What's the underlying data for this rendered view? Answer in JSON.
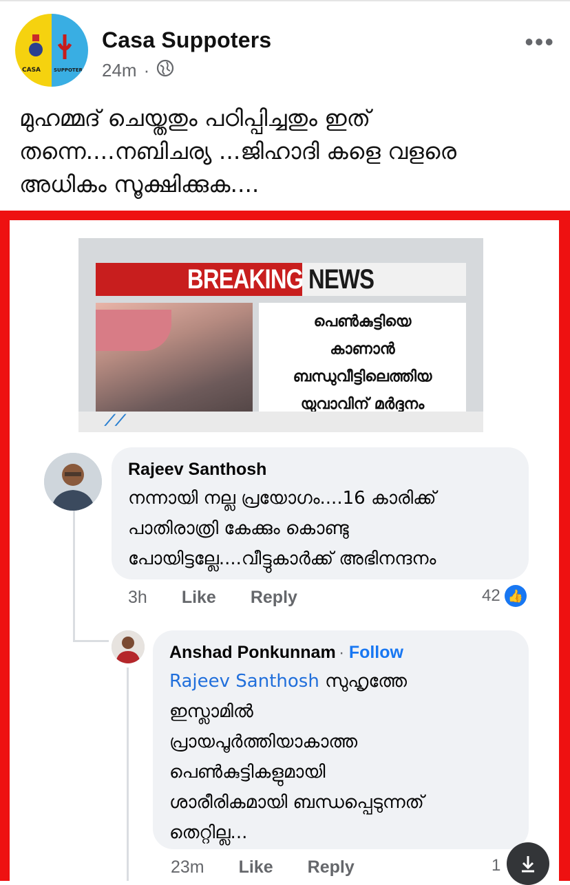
{
  "post": {
    "page_name": "Casa Suppoters",
    "time": "24m",
    "privacy_icon": "globe-icon",
    "more_icon": "more-dots-icon",
    "caption_lines": [
      "മുഹമ്മദ് ചെയ്തതും പഠിപ്പിച്ചതും ഇത്",
      "തന്നെ....നബിചര്യ ...ജിഹാദി കളെ വളരെ",
      "അധികം സൂക്ഷിക്കുക...."
    ],
    "avatar_labels": {
      "left": "CASA",
      "right": "SUPPOTERS"
    }
  },
  "news_image": {
    "breaking": "BREAKING",
    "news": "NEWS",
    "headline_lines": [
      "പെൺകുട്ടിയെ",
      "കാണാൻ",
      "ബന്ധുവീട്ടിലെത്തിയ",
      "യുവാവിന് മർദ്ദനം"
    ]
  },
  "comments": [
    {
      "author": "Rajeev Santhosh",
      "text_lines": [
        "നന്നായി നല്ല പ്രയോഗം....16 കാരിക്ക്",
        "പാതിരാത്രി കേക്കും കൊണ്ടു",
        "പോയിട്ടല്ലേ....വീട്ടുകാർക്ക് അഭിനന്ദനം"
      ],
      "time": "3h",
      "like": "Like",
      "reply": "Reply",
      "reaction_count": "42"
    },
    {
      "author": "Anshad Ponkunnam",
      "follow": "Follow",
      "mention": "Rajeev Santhosh",
      "text_first": " സുഹൃത്തേ",
      "text_lines": [
        "ഇസ്ലാമിൽ",
        "പ്രായപൂർത്തിയാകാത്ത",
        "പെൺകുട്ടികളുമായി",
        "ശാരീരികമായി ബന്ധപ്പെടുന്നത്",
        "തെറ്റില്ല..."
      ],
      "time": "23m",
      "like": "Like",
      "reply": "Reply",
      "reaction_count": "1"
    }
  ],
  "colors": {
    "frame": "#ee1111",
    "facebook_blue": "#1877f2",
    "avatar_yellow": "#f5d20f",
    "avatar_blue": "#39aee3"
  }
}
